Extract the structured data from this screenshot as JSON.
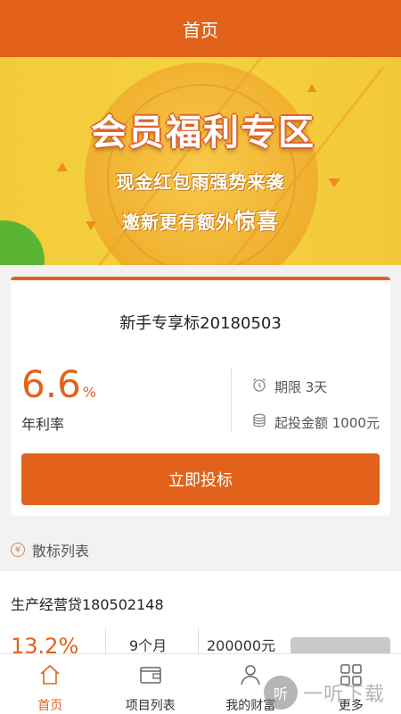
{
  "header": {
    "title": "首页"
  },
  "banner": {
    "title": "会员福利专区",
    "line1": "现金红包雨强势来袭",
    "line2_prefix": "邀新更有额外",
    "line2_highlight": "惊喜"
  },
  "featured": {
    "title": "新手专享标20180503",
    "rate_value": "6.6",
    "rate_unit": "%",
    "rate_label": "年利率",
    "term_label": "期限 3天",
    "min_amount_label": "起投金额 1000元",
    "invest_button": "立即投标"
  },
  "section": {
    "title": "散标列表",
    "icon": "yen-icon"
  },
  "list": {
    "items": [
      {
        "name": "生产经营贷180502148",
        "rate": "13.2%",
        "term": "9个月",
        "amount": "200000元"
      }
    ]
  },
  "tabs": [
    {
      "label": "首页",
      "icon": "home-icon",
      "active": true
    },
    {
      "label": "项目列表",
      "icon": "wallet-icon",
      "active": false
    },
    {
      "label": "我的财富",
      "icon": "user-icon",
      "active": false
    },
    {
      "label": "更多",
      "icon": "grid-icon",
      "active": false
    }
  ],
  "watermark": {
    "text": "一听下载",
    "logo": "听"
  },
  "colors": {
    "accent": "#e2621b",
    "banner": "#f3cb3b",
    "background": "#f2f2f2"
  }
}
